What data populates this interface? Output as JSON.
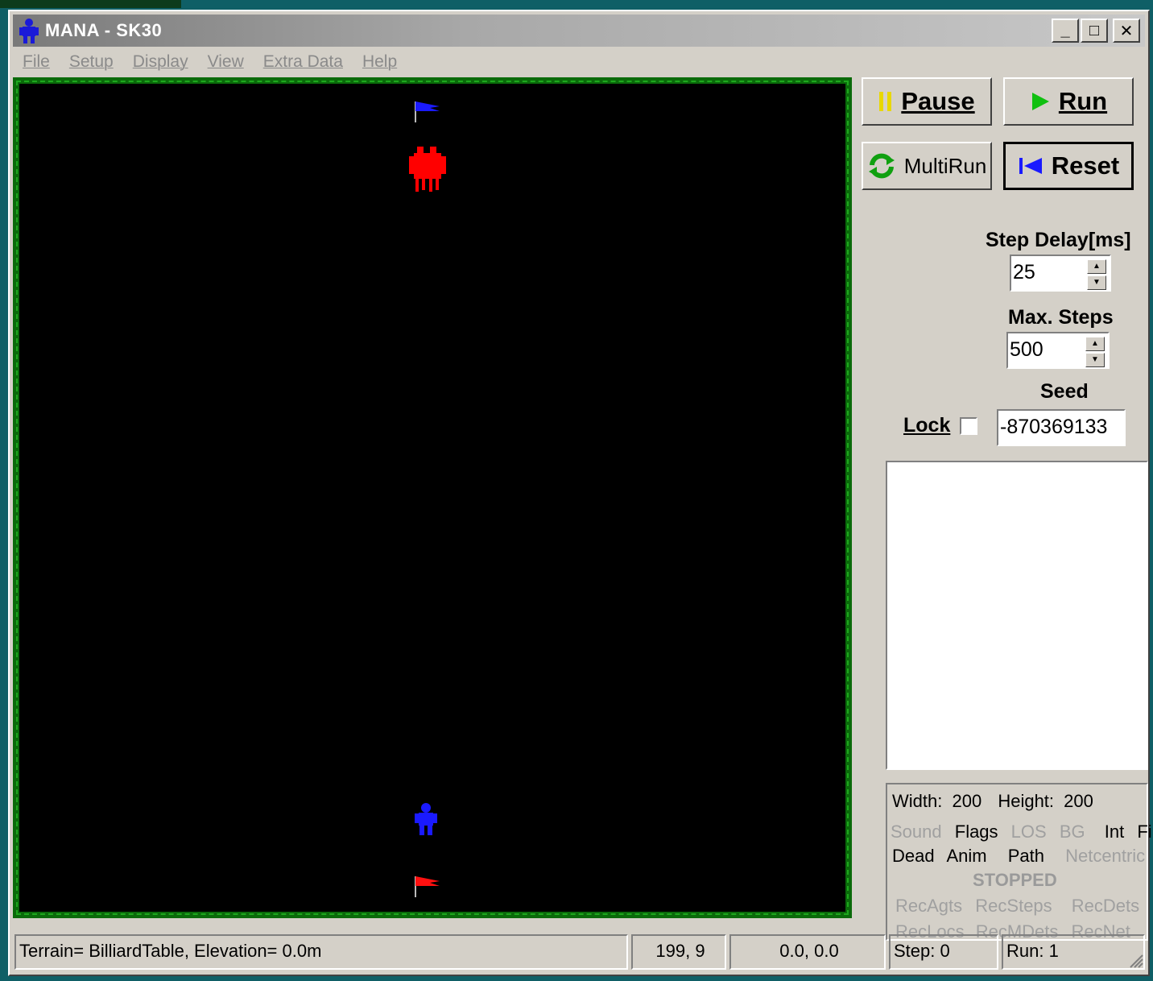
{
  "window": {
    "title": "MANA - SK30",
    "min_glyph": "_",
    "max_glyph": "□",
    "close_glyph": "✕"
  },
  "menu": [
    "File",
    "Setup",
    "Display",
    "View",
    "Extra Data",
    "Help"
  ],
  "controls": {
    "pause_label": "Pause",
    "run_label": "Run",
    "multirun_label": "MultiRun",
    "reset_label": "Reset",
    "step_delay_label": "Step Delay[ms]",
    "step_delay_value": "25",
    "max_steps_label": "Max. Steps",
    "max_steps_value": "500",
    "seed_label": "Seed",
    "lock_label": "Lock",
    "seed_value": "-870369133"
  },
  "info": {
    "width_label": "Width:",
    "width_value": "200",
    "height_label": "Height:",
    "height_value": "200",
    "toggles_row1": [
      {
        "label": "Sound",
        "on": false
      },
      {
        "label": "Flags",
        "on": true
      },
      {
        "label": "LOS",
        "on": false
      },
      {
        "label": "BG",
        "on": false
      },
      {
        "label": "Int",
        "on": true
      },
      {
        "label": "Fire",
        "on": true
      }
    ],
    "toggles_row2": [
      {
        "label": "Dead",
        "on": true
      },
      {
        "label": "Anim",
        "on": true
      },
      {
        "label": "Path",
        "on": true
      },
      {
        "label": "Netcentric",
        "on": false
      }
    ],
    "status": "STOPPED",
    "rec_row1": [
      "RecAgts",
      "RecSteps",
      "RecDets"
    ],
    "rec_row2": [
      "RecLocs",
      "RecMDets",
      "RecNet"
    ]
  },
  "statusbar": {
    "terrain": "Terrain= BilliardTable,  Elevation= 0.0m",
    "cursor": "199, 9",
    "coords": "0.0, 0.0",
    "step": "Step: 0",
    "run": "Run: 1"
  },
  "colors": {
    "red_force": "#ff0000",
    "blue_force": "#0000ff",
    "field_bg": "#000000",
    "field_border": "#0a6a0a"
  },
  "icons": {
    "app": "soldier-icon",
    "pause": "pause-icon",
    "run": "play-icon",
    "multirun": "refresh-icon",
    "reset": "skip-back-icon"
  }
}
